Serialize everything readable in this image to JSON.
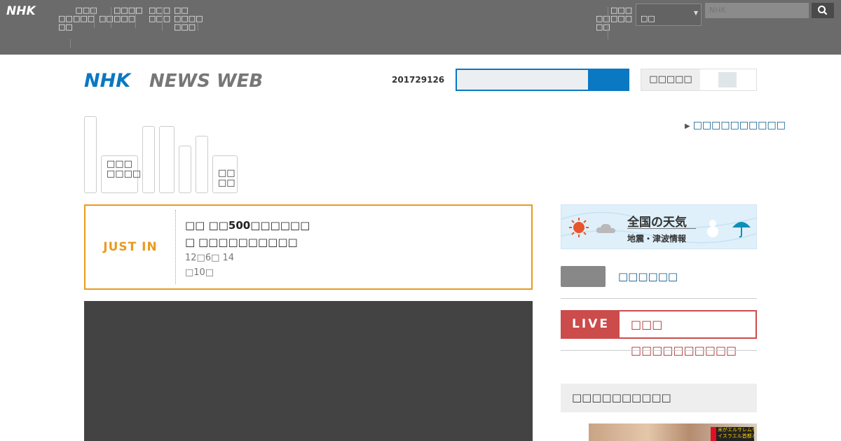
{
  "global_bar": {
    "logo_text": "NHK",
    "nav": [
      {
        "label": "□□\n□□"
      },
      {
        "label": " □□□\n□□□"
      },
      {
        "label": "□□"
      },
      {
        "label": "□□□□\n□□□"
      },
      {
        "label": "□□□\n□□□"
      },
      {
        "label": "□□\n□□□□\n□□□"
      }
    ],
    "right_nav": [
      {
        "label": "□□\n□□"
      },
      {
        "label": "□□□\n□□□"
      }
    ],
    "region_select": "□□",
    "search_placeholder": "NHK"
  },
  "header": {
    "logo_nhk": "NHK",
    "logo_news_web": "NEWS WEB",
    "date": "201729126",
    "lang_label": "□□□□□"
  },
  "links": {
    "top_right": "□□□□□□□□□□"
  },
  "categories": [
    {
      "label": ""
    },
    {
      "label": "□□□\n□□□□"
    },
    {
      "label": ""
    },
    {
      "label": ""
    },
    {
      "label": ""
    },
    {
      "label": ""
    },
    {
      "label": "□□\n□□"
    }
  ],
  "just_in": {
    "label": "JUST IN",
    "title_line1": "□□ □□500□□□□□□",
    "title_line2": "□ □□□□□□□□□□",
    "date": "12□6□ 14\n□10□"
  },
  "sidebar": {
    "weather_title": "全国の天気",
    "weather_sub": "地震・津波情報",
    "side_link": "□□□□□□",
    "live_tag": "LIVE",
    "live_text": "□□□ □□□□□□□□□□",
    "heading": "□□□□□□□□□□",
    "thumb_caption_1": "米がエルサレムを",
    "thumb_caption_2": "イスラエル首都と認定へ"
  },
  "colors": {
    "nhk_blue": "#0a78c2",
    "just_in_orange": "#e89b1f",
    "live_red": "#cc4b4b"
  }
}
